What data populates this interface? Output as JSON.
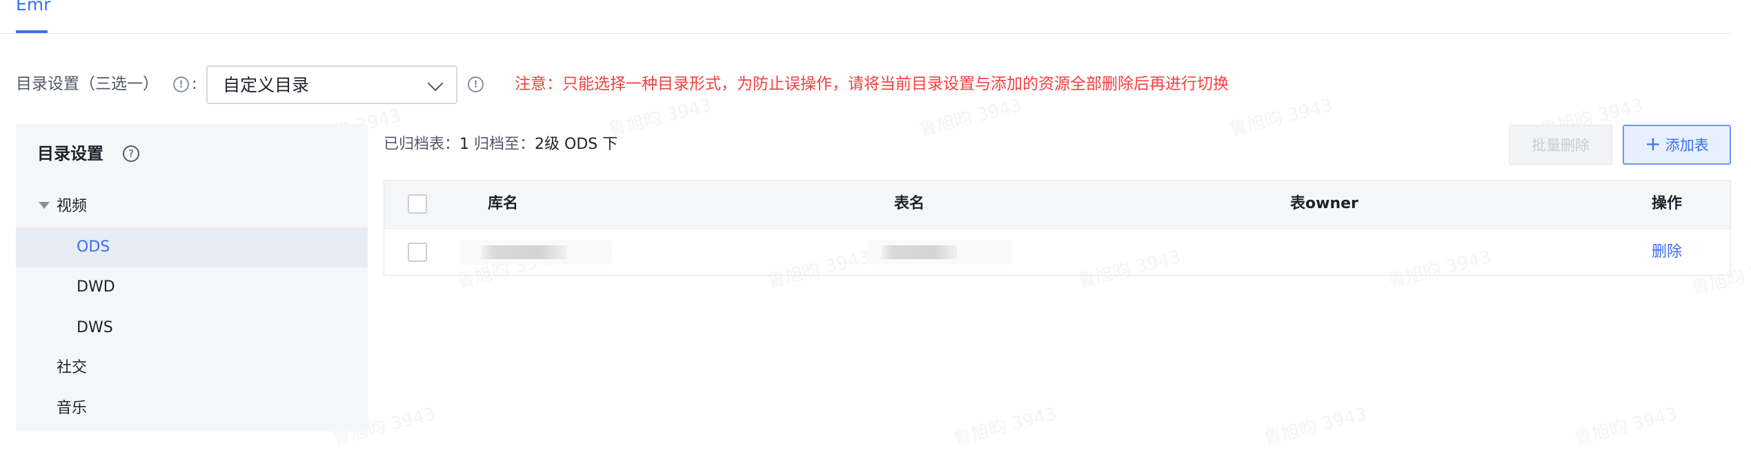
{
  "tabs": {
    "active": "Emr"
  },
  "catalog_setting": {
    "label": "目录设置（三选一）",
    "colon": ":",
    "select_value": "自定义目录",
    "notice": "注意：只能选择一种目录形式，为防止误操作，请将当前目录设置与添加的资源全部删除后再进行切换"
  },
  "sidebar": {
    "title": "目录设置",
    "tree": [
      {
        "label": "视频",
        "expanded": true,
        "children": [
          "ODS",
          "DWD",
          "DWS"
        ]
      },
      {
        "label": "社交"
      },
      {
        "label": "音乐"
      }
    ],
    "active_item": "ODS"
  },
  "archive": {
    "count_label": "已归档表：",
    "count_value": "1",
    "target_label": "归档至：",
    "target_value": "2级 ODS 下"
  },
  "toolbar": {
    "batch_delete_label": "批量删除",
    "add_table_label": "添加表"
  },
  "table": {
    "headers": {
      "db_name": "库名",
      "table_name": "表名",
      "owner": "表owner",
      "action": "操作"
    },
    "rows": [
      {
        "action": "删除"
      }
    ]
  },
  "watermark": "鲁旭昀 3943",
  "colors": {
    "accent": "#3c6ef0",
    "warning": "#f53f3f"
  }
}
